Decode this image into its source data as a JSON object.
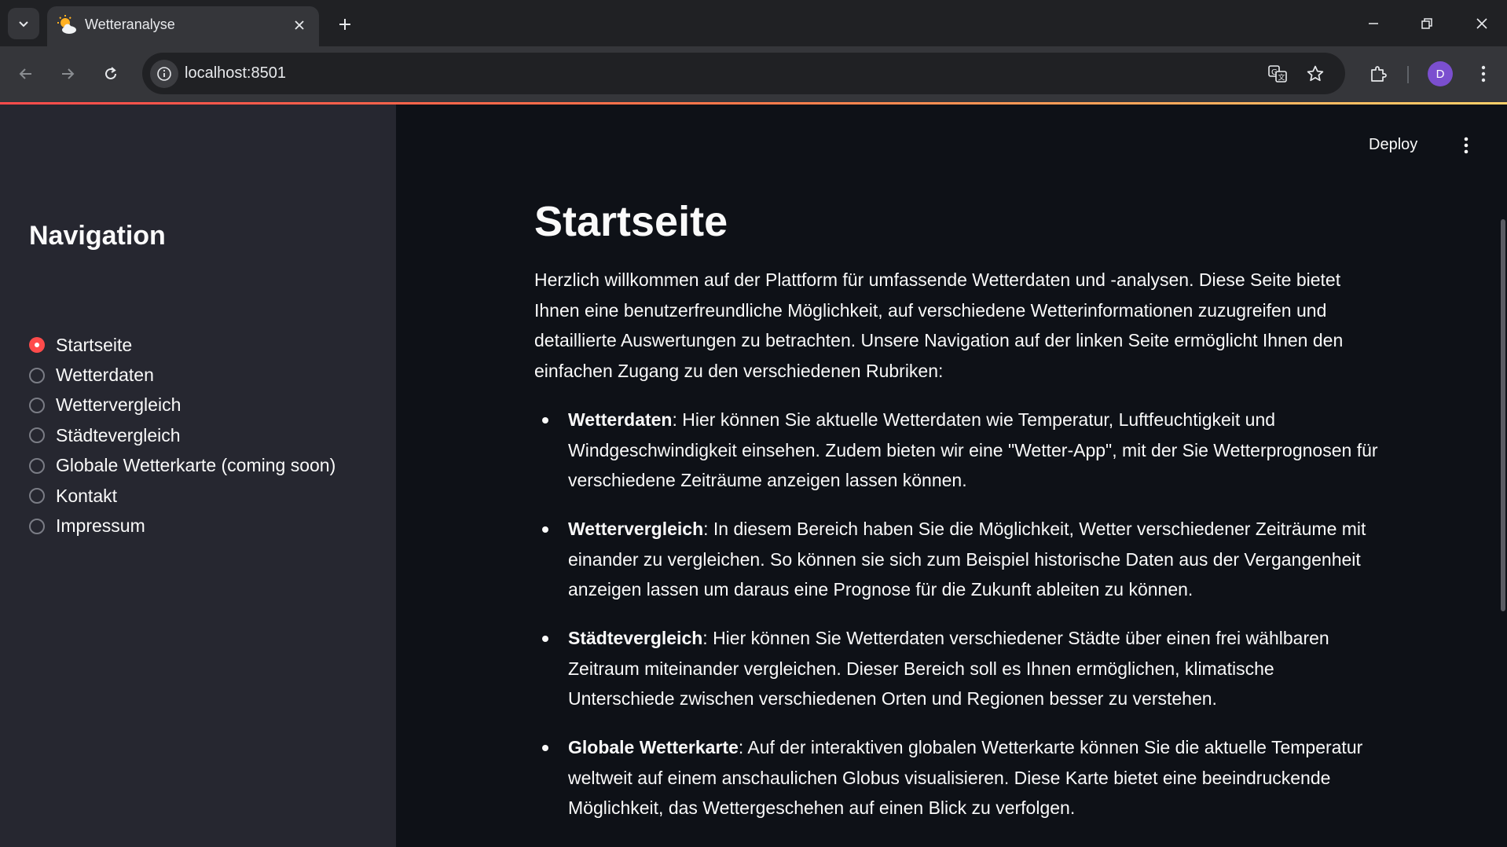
{
  "browser": {
    "tab_title": "Wetteranalyse",
    "url": "localhost:8501",
    "profile_initial": "D"
  },
  "app": {
    "deploy_label": "Deploy"
  },
  "sidebar": {
    "title": "Navigation",
    "options": [
      {
        "label": "Startseite",
        "selected": true
      },
      {
        "label": "Wetterdaten",
        "selected": false
      },
      {
        "label": "Wettervergleich",
        "selected": false
      },
      {
        "label": "Städtevergleich",
        "selected": false
      },
      {
        "label": "Globale Wetterkarte (coming soon)",
        "selected": false
      },
      {
        "label": "Kontakt",
        "selected": false
      },
      {
        "label": "Impressum",
        "selected": false
      }
    ]
  },
  "main": {
    "title": "Startseite",
    "intro": "Herzlich willkommen auf der Plattform für umfassende Wetterdaten und -analysen. Diese Seite bietet Ihnen eine benutzerfreundliche Möglichkeit, auf verschiedene Wetterinformationen zuzugreifen und detaillierte Auswertungen zu betrachten. Unsere Navigation auf der linken Seite ermöglicht Ihnen den einfachen Zugang zu den verschiedenen Rubriken:",
    "bullets": [
      {
        "term": "Wetterdaten",
        "text": ": Hier können Sie aktuelle Wetterdaten wie Temperatur, Luftfeuchtigkeit und Windgeschwindigkeit einsehen. Zudem bieten wir eine \"Wetter-App\", mit der Sie Wetterprognosen für verschiedene Zeiträume anzeigen lassen können."
      },
      {
        "term": "Wettervergleich",
        "text": ": In diesem Bereich haben Sie die Möglichkeit, Wetter verschiedener Zeiträume mit einander zu vergleichen. So können sie sich zum Beispiel historische Daten aus der Vergangenheit anzeigen lassen um daraus eine Prognose für die Zukunft ableiten zu können."
      },
      {
        "term": "Städtevergleich",
        "text": ": Hier können Sie Wetterdaten verschiedener Städte über einen frei wählbaren Zeitraum miteinander vergleichen. Dieser Bereich soll es Ihnen ermöglichen, klimatische Unterschiede zwischen verschiedenen Orten und Regionen besser zu verstehen."
      },
      {
        "term": "Globale Wetterkarte",
        "text": ": Auf der interaktiven globalen Wetterkarte können Sie die aktuelle Temperatur weltweit auf einem anschaulichen Globus visualisieren. Diese Karte bietet eine beeindruckende Möglichkeit, das Wettergeschehen auf einen Blick zu verfolgen."
      }
    ]
  },
  "icons": {
    "favicon": "sun-behind-cloud-icon",
    "accent_color": "#ff4b4b"
  }
}
